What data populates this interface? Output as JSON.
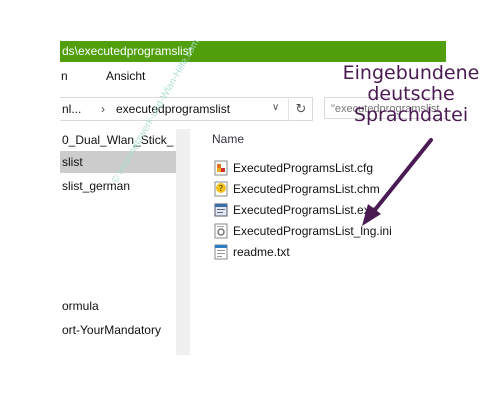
{
  "window": {
    "title": "ds\\executedprogramslist",
    "ribbon_tabs": [
      "n",
      "Ansicht"
    ]
  },
  "address": {
    "segment_prev": "nl...",
    "segment_current": "executedprogramslist",
    "search_placeholder": "\"executedprogramslist"
  },
  "nav": {
    "items": [
      {
        "label": "0_Dual_Wlan_Stick_",
        "selected": false
      },
      {
        "label": "slist",
        "selected": true
      },
      {
        "label": "slist_german",
        "selected": false
      },
      {
        "label": "ormula",
        "selected": false
      },
      {
        "label": "ort-YourMandatory",
        "selected": false
      }
    ]
  },
  "files": {
    "column_name": "Name",
    "items": [
      {
        "name": "ExecutedProgramsList.cfg",
        "icon": "config-file-icon"
      },
      {
        "name": "ExecutedProgramsList.chm",
        "icon": "help-file-icon"
      },
      {
        "name": "ExecutedProgramsList.exe",
        "icon": "application-icon"
      },
      {
        "name": "ExecutedProgramsList_lng.ini",
        "icon": "settings-file-icon"
      },
      {
        "name": "readme.txt",
        "icon": "text-file-icon"
      }
    ]
  },
  "annotation": {
    "line1": "Eingebundene",
    "line2": "deutsche",
    "line3": "Sprachdatei",
    "color": "#4a1a52"
  },
  "watermark": "© Heimnetzwerk-und-Wlan-Hilfe.com",
  "colors": {
    "titlebar": "#519f0c",
    "selected": "#cccccc"
  }
}
